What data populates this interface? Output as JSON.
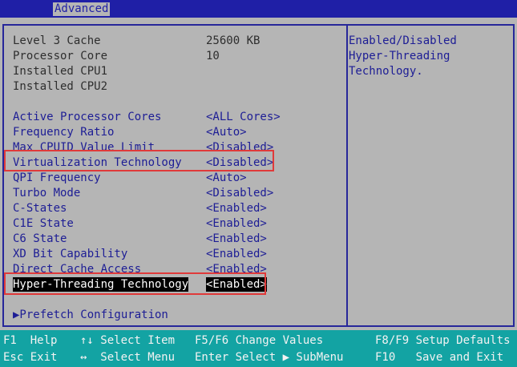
{
  "header": {
    "active_tab": "Advanced"
  },
  "info_rows": [
    {
      "label": "Level 3 Cache",
      "value": "25600 KB"
    },
    {
      "label": "Processor Core",
      "value": "10"
    },
    {
      "label": "Installed CPU1",
      "value": ""
    },
    {
      "label": "Installed CPU2",
      "value": ""
    }
  ],
  "settings": [
    {
      "label": "Active Processor Cores",
      "value": "<ALL Cores>"
    },
    {
      "label": "Frequency Ratio",
      "value": "<Auto>"
    },
    {
      "label": "Max CPUID Value Limit",
      "value": "<Disabled>"
    },
    {
      "label": "Virtualization Technology",
      "value": "<Disabled>"
    },
    {
      "label": "QPI Frequency",
      "value": "<Auto>"
    },
    {
      "label": "Turbo Mode",
      "value": "<Disabled>"
    },
    {
      "label": "C-States",
      "value": "<Enabled>"
    },
    {
      "label": "C1E State",
      "value": "<Enabled>"
    },
    {
      "label": "C6 State",
      "value": "<Enabled>"
    },
    {
      "label": "XD Bit Capability",
      "value": "<Enabled>"
    },
    {
      "label": "Direct Cache Access",
      "value": "<Enabled>"
    },
    {
      "label": "Hyper-Threading Technology",
      "value": "<Enabled>"
    }
  ],
  "submenu": {
    "label": "▶Prefetch Configuration"
  },
  "help": {
    "line1": "Enabled/Disabled",
    "line2": "Hyper-Threading",
    "line3": "Technology."
  },
  "footer": {
    "f1": "F1  Help",
    "esc": "Esc Exit",
    "select_item": "↑↓ Select Item",
    "select_menu": "↔  Select Menu",
    "change_values": "F5/F6 Change Values",
    "enter_submenu": "Enter Select ▶ SubMenu",
    "setup_defaults": "F8/F9 Setup Defaults",
    "save_exit": "F10   Save and Exit"
  },
  "colors": {
    "background": "#b5b5b5",
    "header": "#1f1fa6",
    "option_text": "#1d1d95",
    "footer": "#13a3a3",
    "highlight_border": "#e03a3a"
  }
}
